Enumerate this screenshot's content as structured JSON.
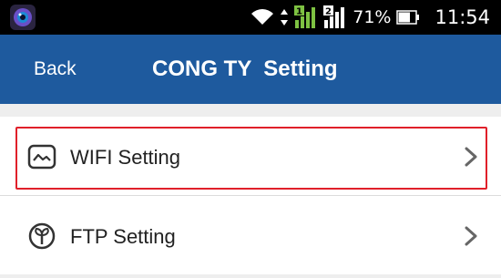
{
  "status_bar": {
    "app_icon": "camera-app-icon",
    "wifi_icon": "wifi-icon",
    "data_arrows_icon": "data-transfer-icon",
    "sim1_label": "1",
    "sim2_label": "2",
    "battery_percent": "71%",
    "time": "11:54"
  },
  "header": {
    "back_label": "Back",
    "title": "CONG TY  Setting",
    "background_color": "#1e5a9e"
  },
  "settings_list": {
    "items": [
      {
        "label": "WIFI Setting",
        "icon": "wifi-settings-icon",
        "selected": true
      },
      {
        "label": "FTP Setting",
        "icon": "ftp-icon",
        "selected": false
      }
    ]
  },
  "colors": {
    "highlight_border": "#e0202a",
    "signal_green": "#7ec242"
  }
}
